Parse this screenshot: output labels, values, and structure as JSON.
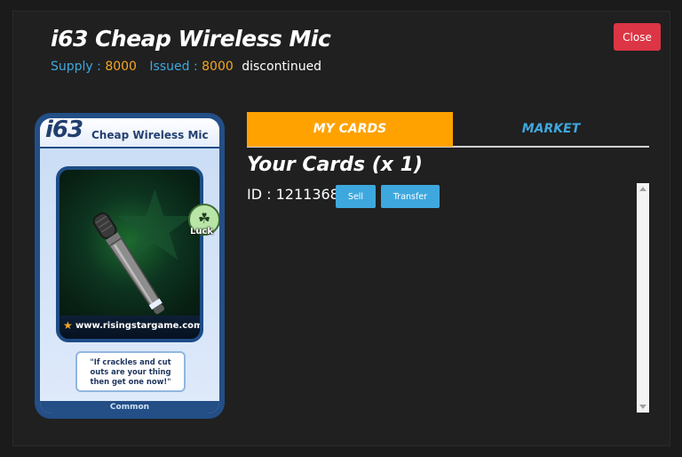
{
  "header": {
    "title": "i63 Cheap Wireless Mic",
    "supply_label": "Supply :",
    "supply_value": "8000",
    "issued_label": "Issued :",
    "issued_value": "8000",
    "status": "discontinued",
    "close_label": "Close"
  },
  "card": {
    "number": "i63",
    "name": "Cheap Wireless Mic",
    "badge_label": "Luck",
    "website": "www.risingstargame.com",
    "quote": "\"If crackles and cut outs are your thing then get one now!\"",
    "rarity": "Common"
  },
  "tabs": [
    {
      "label": "MY CARDS",
      "active": true
    },
    {
      "label": "MARKET",
      "active": false
    }
  ],
  "cards_panel": {
    "heading": "Your Cards (x 1)",
    "id_text": "ID : 1211368",
    "sell_label": "Sell",
    "transfer_label": "Transfer"
  },
  "colors": {
    "accent_blue": "#3ea8de",
    "accent_orange": "#ffa200",
    "close_red": "#dc3545"
  },
  "icons": [
    "star-icon",
    "clover-icon",
    "microphone-icon"
  ]
}
